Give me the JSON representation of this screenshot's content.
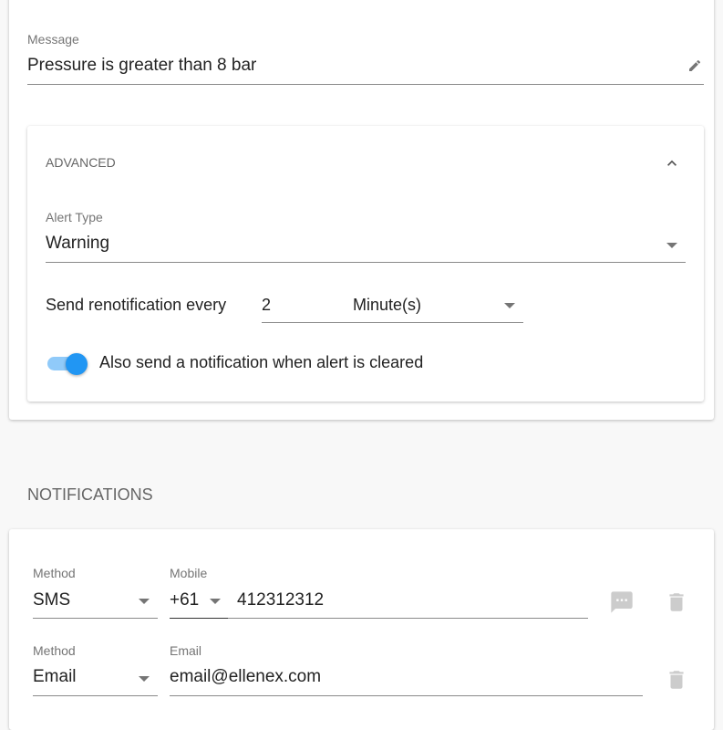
{
  "message": {
    "label": "Message",
    "value": "Pressure is greater than 8 bar"
  },
  "advanced": {
    "title": "ADVANCED",
    "alert_type": {
      "label": "Alert Type",
      "value": "Warning"
    },
    "renotify": {
      "label": "Send renotification every",
      "value": "2",
      "unit": "Minute(s)"
    },
    "cleared_toggle": {
      "label": "Also send a notification when alert is cleared",
      "on": true
    }
  },
  "notifications": {
    "title": "NOTIFICATIONS",
    "rows": [
      {
        "method_label": "Method",
        "method": "SMS",
        "target_label": "Mobile",
        "country_code": "+61",
        "target": "412312312"
      },
      {
        "method_label": "Method",
        "method": "Email",
        "target_label": "Email",
        "target": "email@ellenex.com"
      }
    ]
  },
  "colors": {
    "accent": "#2196f3",
    "accent_light": "#90caf9"
  }
}
